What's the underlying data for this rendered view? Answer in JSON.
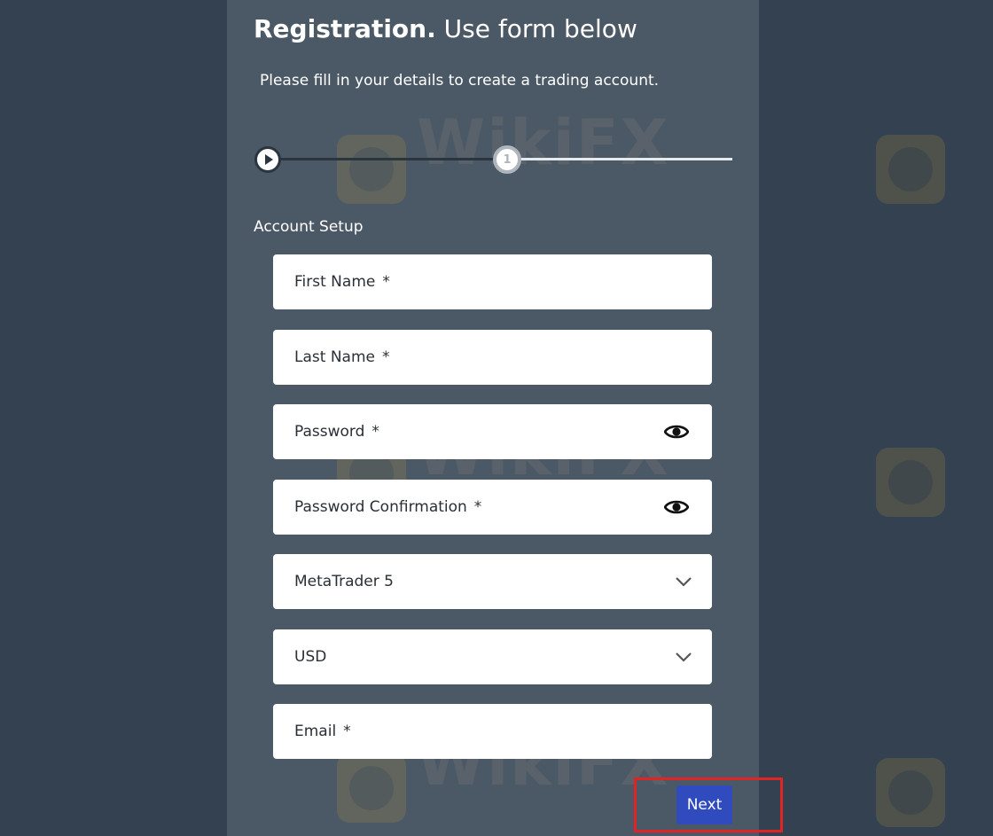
{
  "header": {
    "title_bold": "Registration.",
    "title_rest": " Use form below",
    "subtitle": "Please fill in your details to create a trading account."
  },
  "stepper": {
    "steps": [
      {
        "icon": "play-icon",
        "state": "completed"
      },
      {
        "label": "1",
        "state": "current"
      }
    ]
  },
  "section": {
    "title": "Account Setup"
  },
  "fields": {
    "first_name": {
      "label": "First Name",
      "required": "*"
    },
    "last_name": {
      "label": "Last Name",
      "required": "*"
    },
    "password": {
      "label": "Password",
      "required": "*",
      "icon": "eye-icon"
    },
    "password_confirmation": {
      "label": "Password Confirmation",
      "required": "*",
      "icon": "eye-icon"
    },
    "platform": {
      "value": "MetaTrader 5",
      "icon": "chevron-down-icon"
    },
    "currency": {
      "value": "USD",
      "icon": "chevron-down-icon"
    },
    "email": {
      "label": "Email",
      "required": "*"
    }
  },
  "actions": {
    "next_label": "Next"
  },
  "watermark": {
    "text": "WikiFX"
  },
  "colors": {
    "background": "#334150",
    "panel": "#4b5866",
    "button": "#2f4bbd",
    "highlight": "#e02424"
  }
}
